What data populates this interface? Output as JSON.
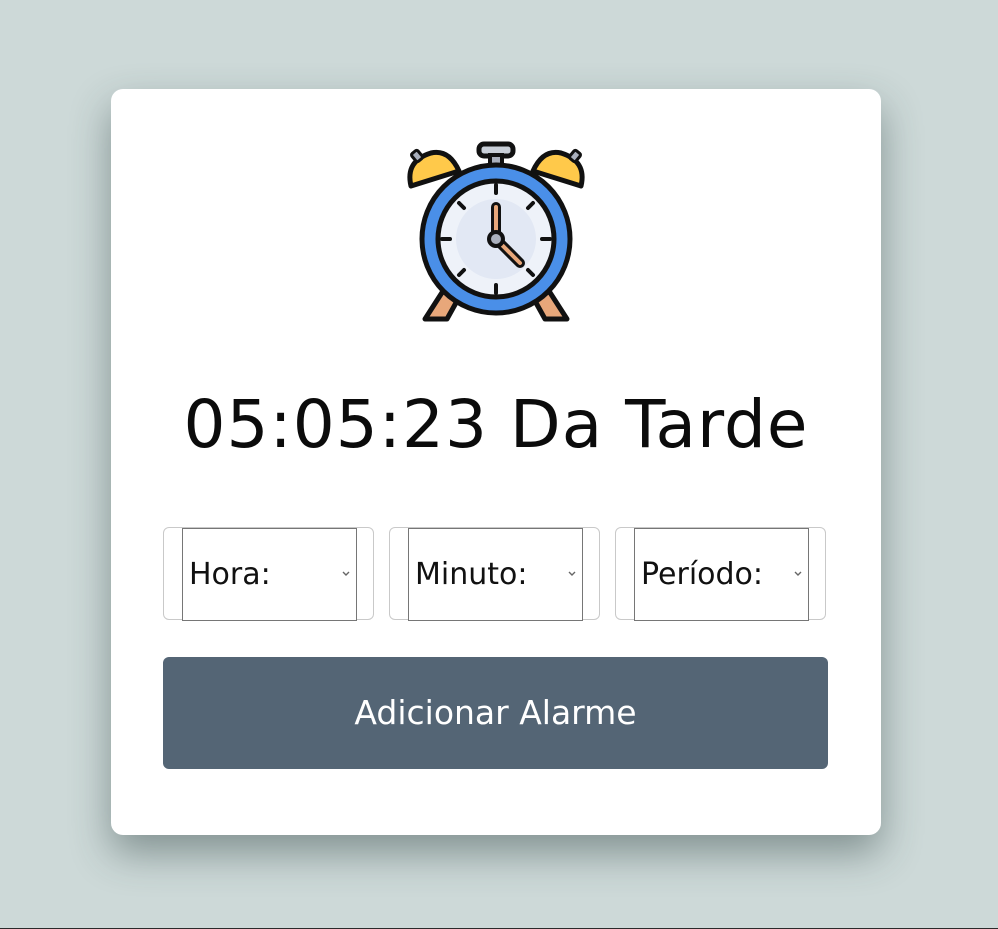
{
  "clock": {
    "icon": "alarm-clock-icon",
    "time_text": "05:05:23 Da Tarde"
  },
  "form": {
    "hour_label": "Hora:",
    "minute_label": "Minuto:",
    "period_label": "Período:",
    "add_button_label": "Adicionar Alarme"
  },
  "colors": {
    "background": "#cdd9d8",
    "card": "#ffffff",
    "button": "#546575",
    "clock_blue": "#4a8fe8",
    "bell_yellow": "#ffc94a",
    "leg_orange": "#e8a77a"
  }
}
